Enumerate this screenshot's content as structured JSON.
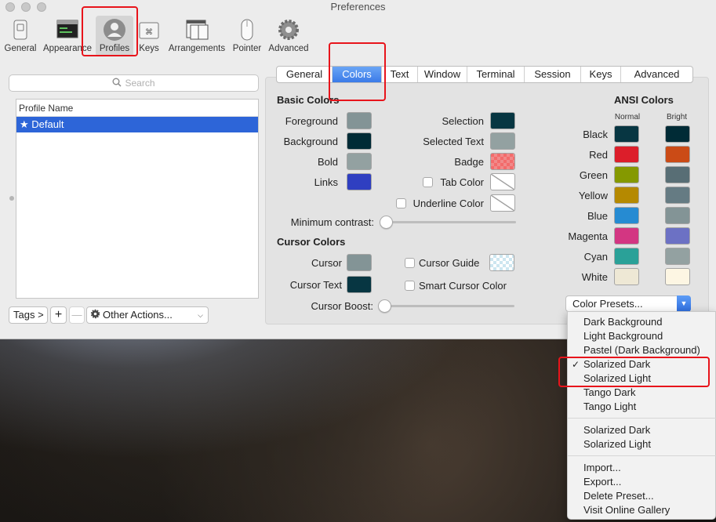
{
  "window": {
    "title": "Preferences"
  },
  "toolbar": {
    "items": [
      {
        "label": "General",
        "icon": "general-icon"
      },
      {
        "label": "Appearance",
        "icon": "appearance-icon"
      },
      {
        "label": "Profiles",
        "icon": "profiles-icon"
      },
      {
        "label": "Keys",
        "icon": "keys-icon"
      },
      {
        "label": "Arrangements",
        "icon": "arrangements-icon"
      },
      {
        "label": "Pointer",
        "icon": "pointer-icon"
      },
      {
        "label": "Advanced",
        "icon": "gear-icon"
      }
    ],
    "selected": "Profiles"
  },
  "sidebar": {
    "search_placeholder": "Search",
    "list_header": "Profile Name",
    "profiles": [
      "★ Default"
    ],
    "tags_label": "Tags >",
    "add_label": "+",
    "remove_label": "—",
    "other_actions_label": "Other Actions..."
  },
  "tabs": {
    "items": [
      "General",
      "Colors",
      "Text",
      "Window",
      "Terminal",
      "Session",
      "Keys",
      "Advanced"
    ],
    "active": "Colors"
  },
  "basic_colors": {
    "heading": "Basic Colors",
    "left": [
      {
        "label": "Foreground",
        "color": "#839496"
      },
      {
        "label": "Background",
        "color": "#002b36"
      },
      {
        "label": "Bold",
        "color": "#93a1a1"
      },
      {
        "label": "Links",
        "color": "#2f3fc1"
      }
    ],
    "right": [
      {
        "label": "Selection",
        "color": "#073642"
      },
      {
        "label": "Selected Text",
        "color": "#93a1a1"
      },
      {
        "label": "Badge",
        "color": "#f36b6b"
      },
      {
        "label": "Tab Color",
        "color": "none",
        "checkbox": true
      },
      {
        "label": "Underline Color",
        "color": "none",
        "checkbox": true
      }
    ],
    "min_contrast_label": "Minimum contrast:",
    "min_contrast_value": 0
  },
  "cursor_colors": {
    "heading": "Cursor Colors",
    "cursor_label": "Cursor",
    "cursor_color": "#839496",
    "cursor_text_label": "Cursor Text",
    "cursor_text_color": "#073642",
    "cursor_guide_label": "Cursor Guide",
    "smart_cursor_label": "Smart Cursor Color",
    "cursor_boost_label": "Cursor Boost:",
    "cursor_boost_value": 0
  },
  "ansi_colors": {
    "heading": "ANSI Colors",
    "normal_label": "Normal",
    "bright_label": "Bright",
    "rows": [
      {
        "label": "Black",
        "normal": "#073642",
        "bright": "#002b36"
      },
      {
        "label": "Red",
        "normal": "#dc1e2a",
        "bright": "#cb4b16"
      },
      {
        "label": "Green",
        "normal": "#859900",
        "bright": "#586e75"
      },
      {
        "label": "Yellow",
        "normal": "#b58900",
        "bright": "#657b83"
      },
      {
        "label": "Blue",
        "normal": "#268bd2",
        "bright": "#839496"
      },
      {
        "label": "Magenta",
        "normal": "#d33682",
        "bright": "#6c71c4"
      },
      {
        "label": "Cyan",
        "normal": "#2aa198",
        "bright": "#93a1a1"
      },
      {
        "label": "White",
        "normal": "#eee8d5",
        "bright": "#fdf6e3"
      }
    ]
  },
  "color_presets": {
    "button_label": "Color Presets...",
    "menu_group1": [
      "Dark Background",
      "Light Background",
      "Pastel (Dark Background)",
      "Solarized Dark",
      "Solarized Light",
      "Tango Dark",
      "Tango Light"
    ],
    "checked": "Solarized Dark",
    "menu_group2": [
      "Solarized Dark",
      "Solarized Light"
    ],
    "menu_group3": [
      "Import...",
      "Export...",
      "Delete Preset...",
      "Visit Online Gallery"
    ]
  },
  "colors": {
    "accent": "#3b7be8",
    "selection": "#2d65d8",
    "highlight_box": "#e8141b"
  }
}
